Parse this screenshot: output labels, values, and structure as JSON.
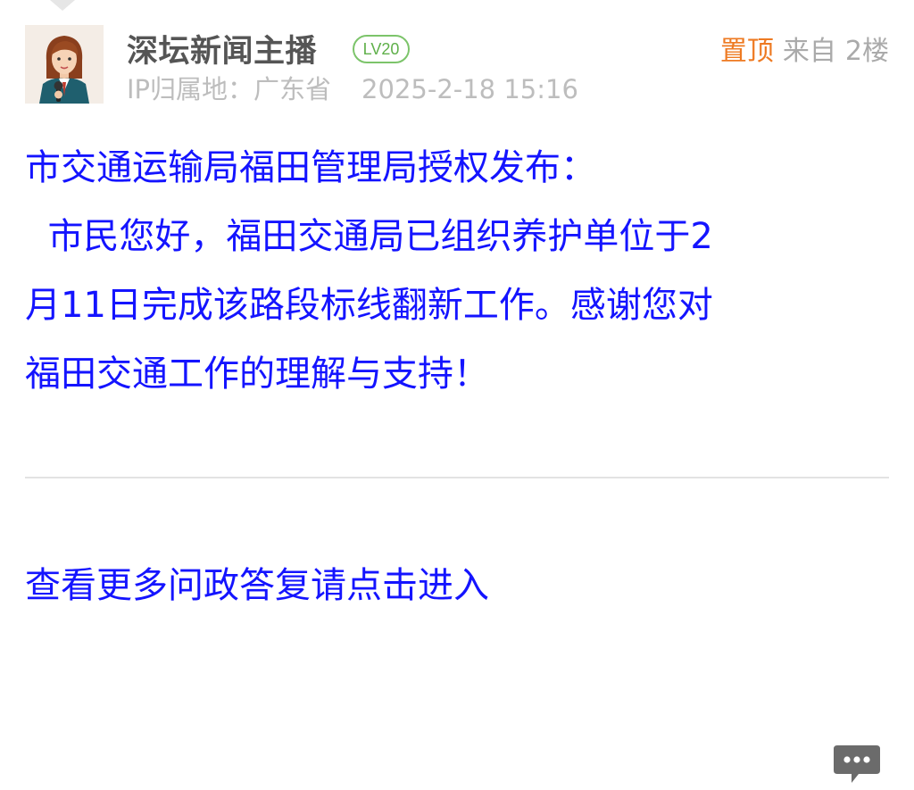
{
  "header": {
    "username": "深坛新闻主播",
    "level": "LV20",
    "ip_location": "IP归属地：广东省",
    "timestamp": "2025-2-18 15:16",
    "pin_label": "置顶",
    "from_label": "来自",
    "floor": "2楼"
  },
  "post": {
    "lines": [
      "市交通运输局福田管理局授权发布：",
      "  市民您好，福田交通局已组织养护单位于2",
      "月11日完成该路段标线翻新工作。感谢您对",
      "福田交通工作的理解与支持！"
    ]
  },
  "more_link": "查看更多问政答复请点击进入",
  "icons": {
    "avatar": "avatar-news-anchor",
    "comment": "comment-bubble-icon"
  },
  "colors": {
    "post_text": "#1414ff",
    "pin": "#ee7a22",
    "level_badge": "#7cc46a",
    "meta": "#bdbdbd",
    "username": "#555555"
  }
}
